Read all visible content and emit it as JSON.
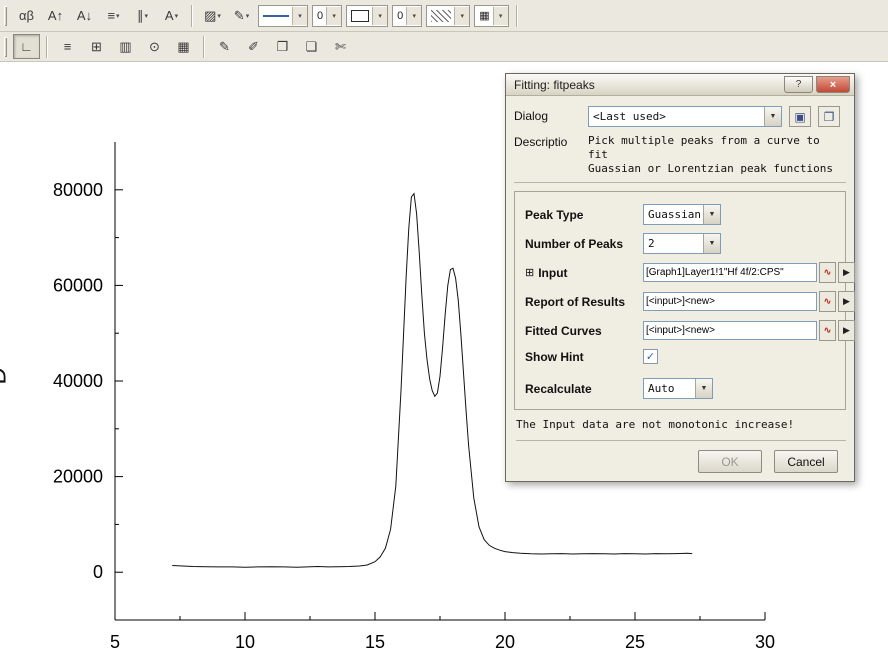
{
  "colors": {
    "line_sample": "#3c5fa0",
    "close_button": "#bf4a35",
    "close_button_top": "#e89c8b"
  },
  "icons": {
    "dropdown": "▼",
    "dropdown_small": "▾",
    "save": "▣",
    "copy": "❐",
    "flyout": "▶",
    "graph_select": "∿",
    "expand": "⊞",
    "check": "✓",
    "help": "?",
    "close": "×"
  },
  "toolbars": {
    "row1": [
      {
        "t": "btn",
        "n": "greek-text-button",
        "g": "αβ"
      },
      {
        "t": "btn",
        "n": "superscript-button",
        "g": "A↑"
      },
      {
        "t": "btn",
        "n": "subscript-button",
        "g": "A↓"
      },
      {
        "t": "btn",
        "n": "text-align-button",
        "g": "≡",
        "dd": true
      },
      {
        "t": "btn",
        "n": "column-format-button",
        "g": "∥",
        "dd": true
      },
      {
        "t": "btn",
        "n": "font-color-button",
        "g": "A",
        "dd": true
      },
      {
        "t": "sep",
        "n": "toolbar-separator"
      },
      {
        "t": "btn",
        "n": "fill-color-button",
        "g": "▨",
        "dd": true
      },
      {
        "t": "btn",
        "n": "line-color-button",
        "g": "✎",
        "dd": true
      },
      {
        "t": "combo",
        "n": "line-style-combo",
        "s": "line",
        "dd": true
      },
      {
        "t": "combo",
        "n": "line-width-combo",
        "g": "0",
        "dd": true
      },
      {
        "t": "combo",
        "n": "border-style-combo",
        "s": "rect",
        "dd": true
      },
      {
        "t": "combo",
        "n": "border-width-combo",
        "g": "0",
        "dd": true
      },
      {
        "t": "combo",
        "n": "fill-pattern-combo",
        "s": "hatch",
        "dd": true
      },
      {
        "t": "combo",
        "n": "grid-style-combo",
        "g": "▦",
        "dd": true
      },
      {
        "t": "sep",
        "n": "toolbar-separator"
      }
    ],
    "row2": [
      {
        "t": "btn",
        "n": "graph-axes-button",
        "g": "∟",
        "pressed": true
      },
      {
        "t": "sep",
        "n": "toolbar-separator"
      },
      {
        "t": "btn",
        "n": "list-view-button",
        "g": "≡"
      },
      {
        "t": "btn",
        "n": "worksheet-button",
        "g": "⊞"
      },
      {
        "t": "btn",
        "n": "column-view-button",
        "g": "▥"
      },
      {
        "t": "btn",
        "n": "recent-items-button",
        "g": "⊙"
      },
      {
        "t": "btn",
        "n": "grid-view-button",
        "g": "▦"
      },
      {
        "t": "sep",
        "n": "toolbar-separator"
      },
      {
        "t": "btn",
        "n": "draw-pencil-button",
        "g": "✎"
      },
      {
        "t": "btn",
        "n": "draw-pen-button",
        "g": "✐"
      },
      {
        "t": "btn",
        "n": "duplicate-button",
        "g": "❐"
      },
      {
        "t": "btn",
        "n": "page-button",
        "g": "❏"
      },
      {
        "t": "btn",
        "n": "cut-button",
        "g": "✄"
      }
    ]
  },
  "dialog": {
    "title": "Fitting: fitpeaks",
    "dialog_label": "Dialog",
    "dialog_value": "<Last used>",
    "description_label": "Descriptio",
    "description_text": "Pick multiple peaks from a curve to fit\nGuassian or Lorentzian peak functions",
    "fields": {
      "peak_type": {
        "label": "Peak Type",
        "value": "Guassian"
      },
      "number_of_peaks": {
        "label": "Number of Peaks",
        "value": "2"
      },
      "input": {
        "label": "Input",
        "value": "[Graph1]Layer1!1\"Hf 4f/2:CPS\""
      },
      "report_of_results": {
        "label": "Report of Results",
        "value": "[<input>]<new>"
      },
      "fitted_curves": {
        "label": "Fitted Curves",
        "value": "[<input>]<new>"
      },
      "show_hint": {
        "label": "Show Hint",
        "checked": true
      },
      "recalculate": {
        "label": "Recalculate",
        "value": "Auto"
      }
    },
    "warning": "The Input data are not monotonic increase!",
    "ok_label": "OK",
    "cancel_label": "Cancel"
  },
  "chart_data": {
    "type": "line",
    "title": "",
    "xlabel": "",
    "ylabel_fragment": "D",
    "xlim": [
      5,
      30
    ],
    "ylim": [
      -10000,
      90000
    ],
    "xticks": [
      5,
      10,
      15,
      20,
      25,
      30
    ],
    "xtick_labels": [
      "5",
      "10",
      "15",
      "20",
      "25",
      "30"
    ],
    "yticks": [
      0,
      20000,
      40000,
      60000,
      80000
    ],
    "ytick_labels": [
      "0",
      "20000",
      "40000",
      "60000",
      "80000"
    ],
    "line_color": "#111111",
    "grid": false,
    "legend": "none",
    "x": [
      7.2,
      7.6,
      8.0,
      8.5,
      9.0,
      9.5,
      10.0,
      10.5,
      11.0,
      11.5,
      12.0,
      12.4,
      12.8,
      13.2,
      13.6,
      14.0,
      14.4,
      14.7,
      15.0,
      15.2,
      15.4,
      15.6,
      15.8,
      16.0,
      16.1,
      16.2,
      16.3,
      16.4,
      16.5,
      16.6,
      16.7,
      16.8,
      16.9,
      17.0,
      17.1,
      17.2,
      17.3,
      17.4,
      17.5,
      17.6,
      17.7,
      17.8,
      17.9,
      18.0,
      18.1,
      18.2,
      18.3,
      18.4,
      18.5,
      18.6,
      18.8,
      19.0,
      19.2,
      19.4,
      19.6,
      19.8,
      20.0,
      20.3,
      20.6,
      21.0,
      21.4,
      21.8,
      22.2,
      22.6,
      23.0,
      23.4,
      23.8,
      24.2,
      24.6,
      25.0,
      25.4,
      25.8,
      26.2,
      26.6,
      27.0,
      27.2
    ],
    "y": [
      1400,
      1300,
      1200,
      1150,
      1100,
      1100,
      1050,
      1100,
      1150,
      1100,
      1050,
      1100,
      1200,
      1100,
      1150,
      1200,
      1300,
      1500,
      2200,
      3200,
      5000,
      9000,
      18000,
      38000,
      50000,
      62000,
      72000,
      78500,
      79200,
      75000,
      67000,
      58000,
      50000,
      44500,
      40500,
      38000,
      36800,
      37500,
      41000,
      47000,
      54000,
      60000,
      63300,
      63600,
      61500,
      57000,
      50000,
      42000,
      34000,
      26500,
      15500,
      9500,
      6800,
      5600,
      5000,
      4600,
      4300,
      4100,
      3950,
      3850,
      3800,
      3850,
      3900,
      3800,
      3850,
      3900,
      3850,
      3800,
      3900,
      3850,
      3800,
      3900,
      3850,
      3900,
      3950,
      3900
    ]
  }
}
